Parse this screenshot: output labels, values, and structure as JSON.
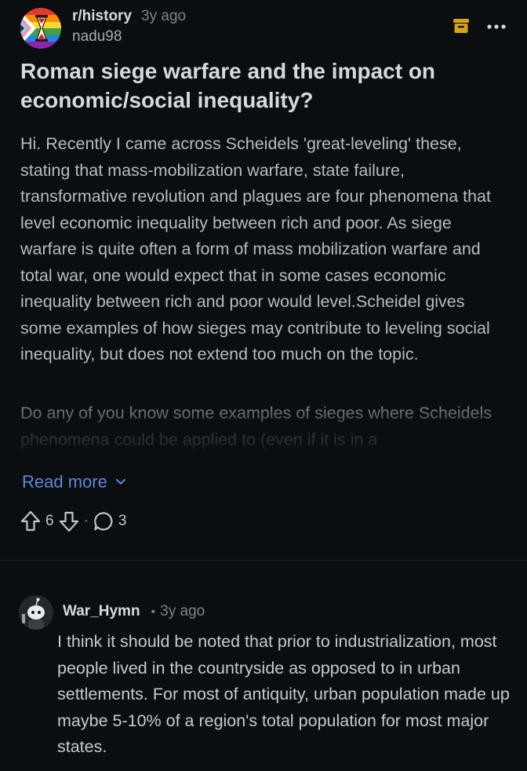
{
  "post": {
    "subreddit": "r/history",
    "time": "3y ago",
    "author": "nadu98",
    "title": "Roman siege warfare and the impact on economic/social inequality?",
    "body_p1": "Hi. Recently I came across Scheidels 'great-leveling' these, stating that mass-mobilization warfare, state failure, transformative revolution and plagues are four phenomena that level economic inequality between rich and poor. As siege warfare is quite often a form of mass mobilization warfare and total war, one would expect that in some cases economic inequality between rich and poor would level.Scheidel gives some examples of how sieges may contribute to leveling social inequality, but does not extend too much on the topic.",
    "body_p2": "Do any of you know some examples of sieges where Scheidels phenomena could be applied to (even if it is in a",
    "read_more": "Read more",
    "upvotes": "6",
    "comments": "3",
    "dot": "·"
  },
  "comment": {
    "author": "War_Hymn",
    "sep": "•",
    "time": "3y ago",
    "text": "I think it should be noted that prior to industrialization, most people lived in the countryside as opposed to in urban settlements. For most of antiquity, urban population made up maybe 5-10% of a region's total population for most major states."
  },
  "icons": {
    "subreddit_avatar": "hourglass-pride-icon",
    "archive": "archive-icon",
    "more": "more-options-icon",
    "upvote": "upvote-arrow-icon",
    "downvote": "downvote-arrow-icon",
    "comments": "comment-bubble-icon",
    "chevron": "chevron-down-icon",
    "comment_avatar": "snoo-avatar-icon"
  },
  "colors": {
    "background": "#0b0e10",
    "link": "#5f86d9",
    "archive": "#d5a21b"
  }
}
